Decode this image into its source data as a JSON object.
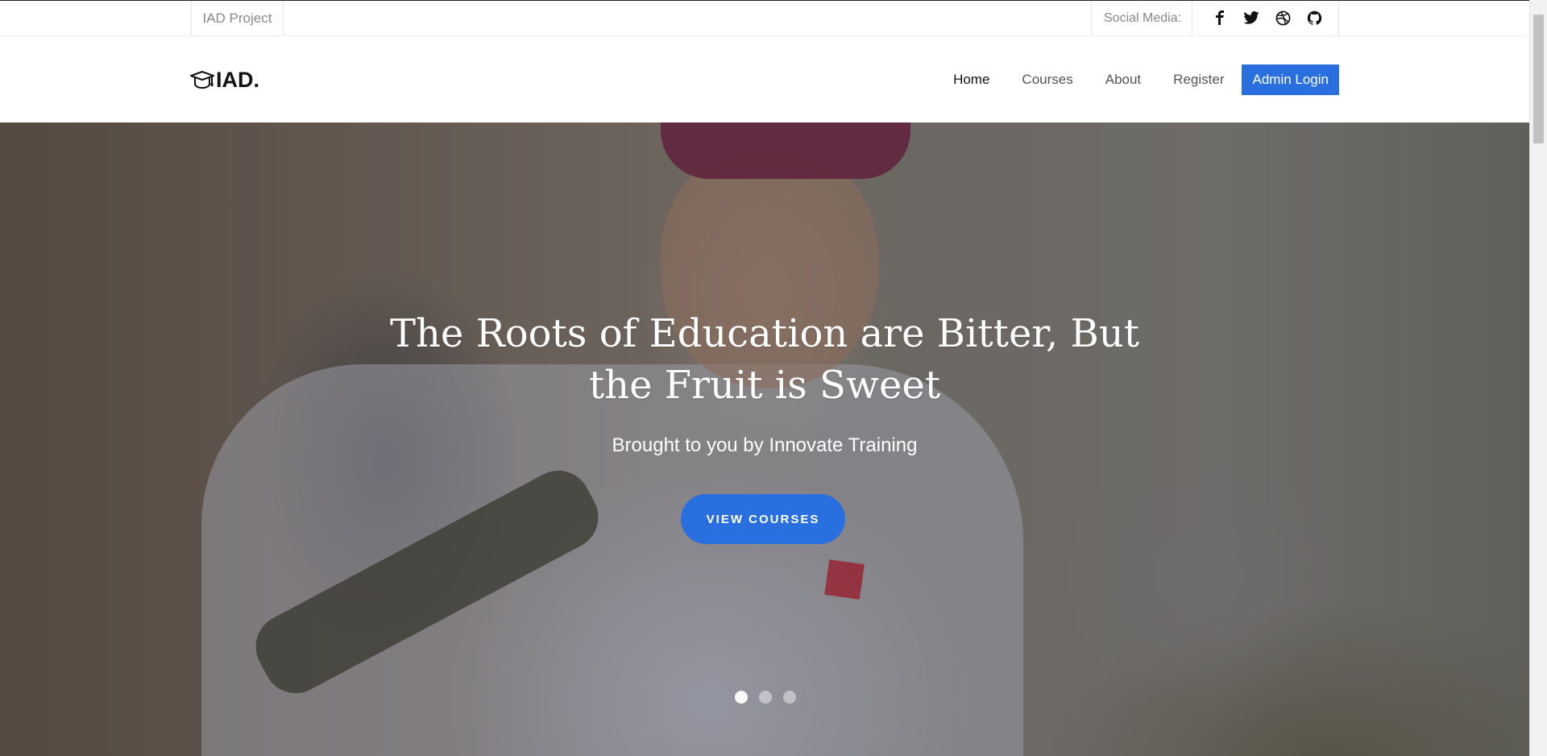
{
  "topbar": {
    "project_name": "IAD Project",
    "social_label": "Social Media:",
    "social_icons": [
      "facebook-icon",
      "twitter-icon",
      "dribbble-icon",
      "github-icon"
    ]
  },
  "header": {
    "logo_text": "IAD.",
    "logo_icon": "graduation-cap-icon",
    "nav": {
      "home": "Home",
      "courses": "Courses",
      "about": "About",
      "register": "Register",
      "admin_login": "Admin Login"
    },
    "accent_color": "#2a6fe0"
  },
  "hero": {
    "title": "The Roots of Education are Bitter, But the Fruit is Sweet",
    "subtitle": "Brought to you by Innovate Training",
    "button_label": "VIEW COURSES",
    "slides_total": 3,
    "active_slide": 1
  }
}
